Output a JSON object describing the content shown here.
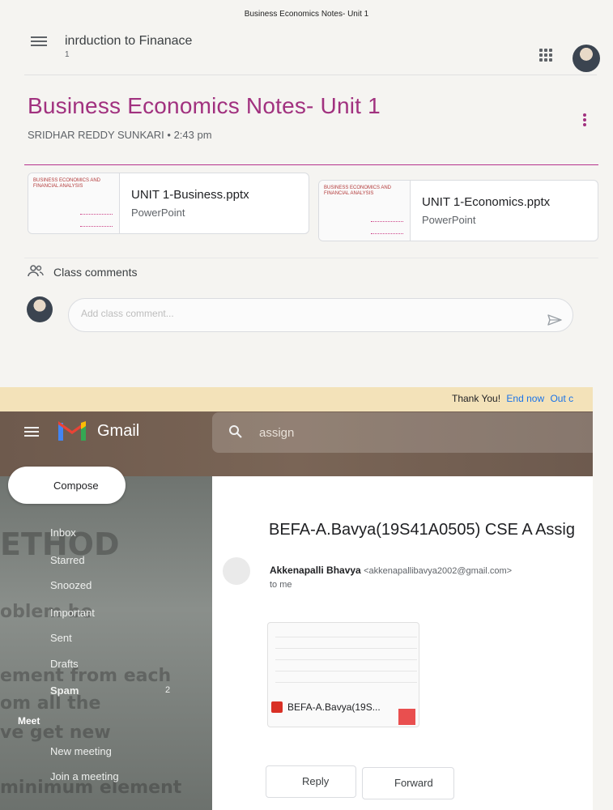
{
  "print_header": "Business Economics Notes- Unit 1",
  "classroom": {
    "course_title": "inrduction to Finanace",
    "course_section": "1",
    "post_title": "Business Economics Notes- Unit 1",
    "post_meta": "SRIDHAR REDDY SUNKARI • 2:43 pm",
    "attachments": [
      {
        "name": "UNIT 1-Business.pptx",
        "type": "PowerPoint",
        "thumb_text": "BUSINESS ECONOMICS AND FINANCIAL ANALYSIS"
      },
      {
        "name": "UNIT 1-Economics.pptx",
        "type": "PowerPoint",
        "thumb_text": "BUSINESS ECONOMICS AND FINANCIAL ANALYSIS"
      }
    ],
    "comments_label": "Class comments",
    "comment_placeholder": "Add class comment..."
  },
  "gmail": {
    "banner": {
      "text": "Thank You!",
      "end_now": "End now",
      "out": "Out c"
    },
    "app_name": "Gmail",
    "search_value": "assign",
    "compose_label": "Compose",
    "nav": [
      "Inbox",
      "Starred",
      "Snoozed",
      "Important",
      "Sent",
      "Drafts",
      "Spam"
    ],
    "spam_count": "2",
    "meet_label": "Meet",
    "meet_items": [
      "New meeting",
      "Join a meeting"
    ],
    "background_text": [
      "ETHOD",
      "oblem be",
      "ement from each",
      "om all the",
      "ve get new",
      "minimum element"
    ],
    "message": {
      "subject": "BEFA-A.Bavya(19S41A0505) CSE A Assig",
      "sender_name": "Akkenapalli Bhavya",
      "sender_email": "<akkenapallibavya2002@gmail.com>",
      "to": "to me",
      "attachment_name": "BEFA-A.Bavya(19S..."
    },
    "reply_label": "Reply",
    "forward_label": "Forward"
  }
}
